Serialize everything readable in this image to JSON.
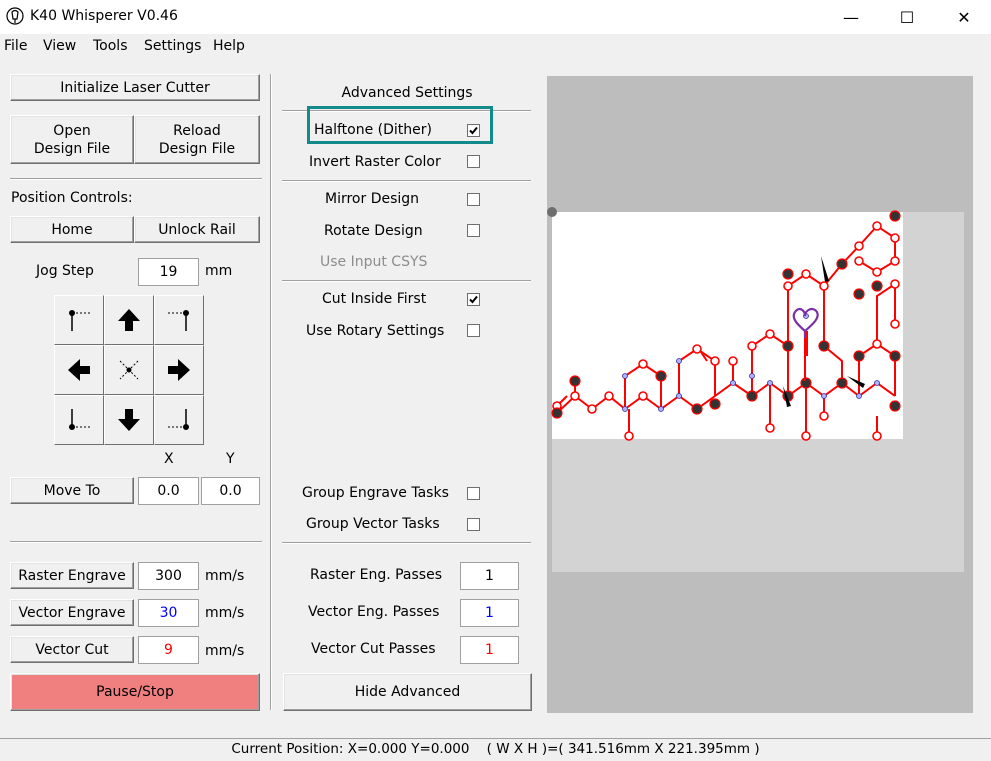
{
  "window": {
    "title": "K40 Whisperer V0.46",
    "minimize": "—",
    "maximize": "☐",
    "close": "✕"
  },
  "menu": [
    "File",
    "View",
    "Tools",
    "Settings",
    "Help"
  ],
  "left": {
    "init_button": "Initialize Laser Cutter",
    "open_button_l1": "Open",
    "open_button_l2": "Design File",
    "reload_button_l1": "Reload",
    "reload_button_l2": "Design File",
    "position_controls": "Position Controls:",
    "home_button": "Home",
    "unlock_button": "Unlock Rail",
    "jog_step_label": "Jog Step",
    "jog_step_value": "19",
    "jog_step_unit": "mm",
    "x_label": "X",
    "y_label": "Y",
    "move_to_button": "Move To",
    "move_x": "0.0",
    "move_y": "0.0",
    "raster_button": "Raster Engrave",
    "raster_speed": "300",
    "raster_unit": "mm/s",
    "vector_engrave_button": "Vector Engrave",
    "vector_engrave_speed": "30",
    "vector_engrave_unit": "mm/s",
    "vector_cut_button": "Vector Cut",
    "vector_cut_speed": "9",
    "vector_cut_unit": "mm/s",
    "pause_button": "Pause/Stop"
  },
  "advanced": {
    "title": "Advanced Settings",
    "halftone": {
      "label": "Halftone (Dither)",
      "checked": true
    },
    "invert": {
      "label": "Invert Raster Color",
      "checked": false
    },
    "mirror": {
      "label": "Mirror Design",
      "checked": false
    },
    "rotate": {
      "label": "Rotate Design",
      "checked": false
    },
    "use_input_csys": "Use Input CSYS",
    "cut_inside": {
      "label": "Cut Inside First",
      "checked": true
    },
    "rotary": {
      "label": "Use Rotary Settings",
      "checked": false
    },
    "group_engrave": {
      "label": "Group Engrave Tasks",
      "checked": false
    },
    "group_vector": {
      "label": "Group Vector Tasks",
      "checked": false
    },
    "raster_passes_label": "Raster Eng. Passes",
    "raster_passes": "1",
    "vector_eng_passes_label": "Vector Eng. Passes",
    "vector_eng_passes": "1",
    "vector_cut_passes_label": "Vector Cut Passes",
    "vector_cut_passes": "1",
    "hide_button": "Hide Advanced"
  },
  "colors": {
    "pause": "#f08080",
    "highlight": "#138a8a",
    "vector_engrave": "#0000ff",
    "vector_cut": "#ff0000"
  },
  "status": "Current Position: X=0.000 Y=0.000    ( W X H )=( 341.516mm X 221.395mm )"
}
